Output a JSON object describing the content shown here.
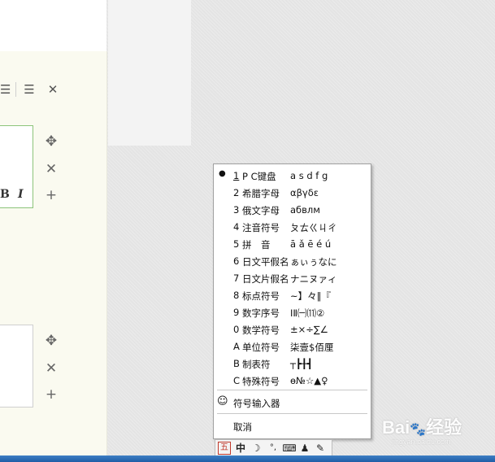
{
  "editor": {
    "format_bold": "B",
    "format_italic": "I"
  },
  "menu": {
    "items": [
      {
        "num": "1",
        "name": "P C键盘",
        "sample": "a s d f g",
        "selected": true
      },
      {
        "num": "2",
        "name": "希腊字母",
        "sample": "αβγδε"
      },
      {
        "num": "3",
        "name": "俄文字母",
        "sample": "абвлм"
      },
      {
        "num": "4",
        "name": "注音符号",
        "sample": "ㄆㄊㄍㄐㄔ"
      },
      {
        "num": "5",
        "name": "拼　音",
        "sample": "ā ǎ ē é ú"
      },
      {
        "num": "6",
        "name": "日文平假名",
        "sample": "ぁぃぅなに"
      },
      {
        "num": "7",
        "name": "日文片假名",
        "sample": "ナニヌァィ"
      },
      {
        "num": "8",
        "name": "标点符号",
        "sample": "~】々‖『"
      },
      {
        "num": "9",
        "name": "数字序号",
        "sample": "ⅠⅡ㈠⑾②"
      },
      {
        "num": "0",
        "name": "数学符号",
        "sample": "±×÷∑∠"
      },
      {
        "num": "A",
        "name": "单位符号",
        "sample": "柒壹$佰厘"
      },
      {
        "num": "B",
        "name": "制表符",
        "sample": "┬┣╂┫"
      },
      {
        "num": "C",
        "name": "特殊符号",
        "sample": "ѳ№☆▲♀"
      }
    ],
    "symbol_input": "符号输入器",
    "cancel": "取消"
  },
  "ime": {
    "mode": "五",
    "lang": "中"
  },
  "watermark": {
    "brand": "Bai",
    "brand2": "经验",
    "url": "jingyan.baidu.com"
  }
}
